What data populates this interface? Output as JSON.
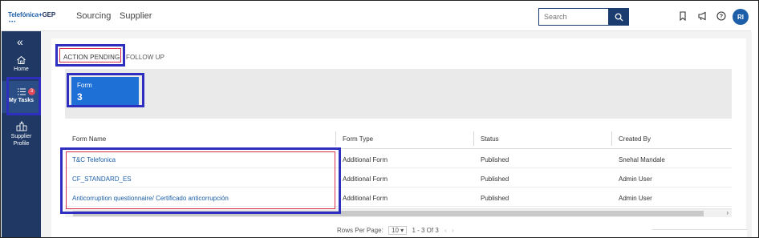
{
  "header": {
    "logo_brand": "Telefónica",
    "logo_sep": "+",
    "logo_partner": "GEP",
    "logo_dots": "•••",
    "nav": [
      "Sourcing",
      "Supplier"
    ],
    "search_placeholder": "Search",
    "avatar_initials": "RI",
    "accent_color": "#1b3c6e"
  },
  "sidebar": {
    "collapse_glyph": "«",
    "items": [
      {
        "label": "Home",
        "icon": "home-icon"
      },
      {
        "label": "My Tasks",
        "icon": "tasks-icon",
        "badge": "3"
      },
      {
        "label": "Supplier Profile",
        "icon": "supplier-profile-icon"
      }
    ],
    "bg_color": "#1f3864"
  },
  "tabs": [
    {
      "label": "ACTION PENDING",
      "active": true
    },
    {
      "label": "FOLLOW UP",
      "active": false
    }
  ],
  "stat": {
    "label": "Form",
    "value": "3",
    "color": "#1e6fd6"
  },
  "table": {
    "columns": [
      "Form Name",
      "Form Type",
      "Status",
      "Created By"
    ],
    "rows": [
      {
        "form_name": "T&C Telefonica",
        "form_type": "Additional Form",
        "status": "Published",
        "created_by": "Snehal Mandale"
      },
      {
        "form_name": "CF_STANDARD_ES",
        "form_type": "Additional Form",
        "status": "Published",
        "created_by": "Admin User"
      },
      {
        "form_name": "Anticorruption questionnaire/ Certificado anticorrupción",
        "form_type": "Additional Form",
        "status": "Published",
        "created_by": "Admin User"
      }
    ]
  },
  "pagination": {
    "rows_per_page_label": "Rows Per Page:",
    "rows_per_page": "10",
    "range": "1 - 3 Of 3"
  },
  "annotation_colors": {
    "outer": "#2e2fbf",
    "inner": "#d9304a"
  }
}
